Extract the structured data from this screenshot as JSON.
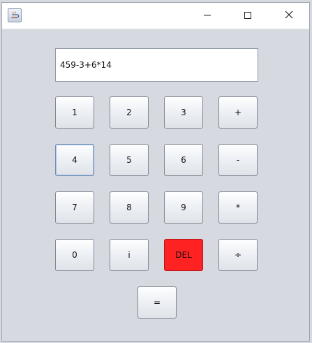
{
  "window": {
    "icon": "java-coffee-icon",
    "controls": {
      "minimize": "minimize-icon",
      "maximize": "maximize-icon",
      "close": "close-icon"
    }
  },
  "calculator": {
    "display_value": "459-3+6*14",
    "buttons": {
      "one": "1",
      "two": "2",
      "three": "3",
      "plus": "+",
      "four": "4",
      "five": "5",
      "six": "6",
      "minus": "-",
      "seven": "7",
      "eight": "8",
      "nine": "9",
      "multiply": "*",
      "zero": "0",
      "i": "i",
      "del": "DEL",
      "divide": "÷",
      "equals": "="
    },
    "colors": {
      "del_button": "#ff2222",
      "window_background": "#d6d9e0"
    }
  }
}
